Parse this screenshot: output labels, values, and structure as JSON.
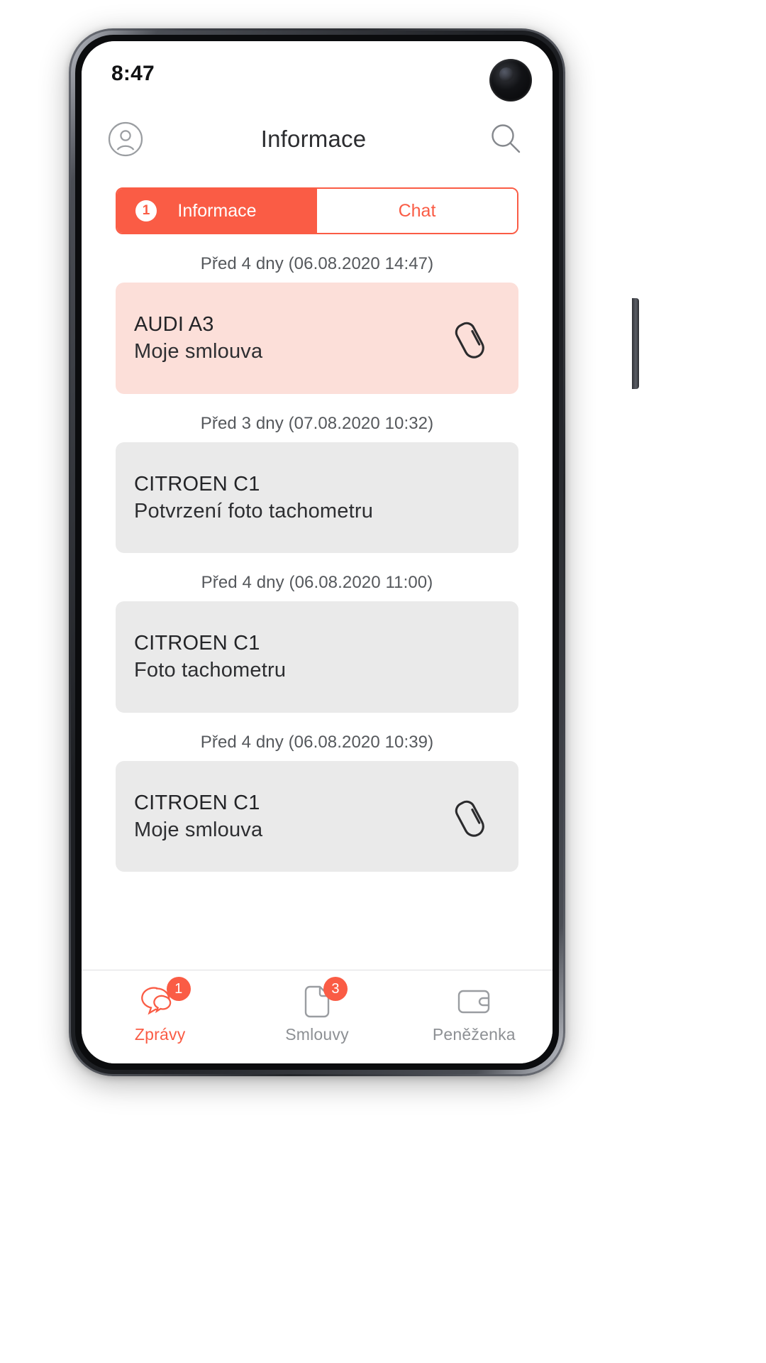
{
  "statusbar": {
    "time": "8:47"
  },
  "appbar": {
    "title": "Informace",
    "profile_icon": "user-circle-icon",
    "search_icon": "search-icon"
  },
  "segmented_tabs": [
    {
      "label": "Informace",
      "badge": "1",
      "active": true
    },
    {
      "label": "Chat",
      "badge": "",
      "active": false
    }
  ],
  "colors": {
    "accent": "#fa5c45",
    "unread_card_bg": "#fcdfd9",
    "read_card_bg": "#eaeaea",
    "inactive_nav": "#8d9094",
    "timestamp_text": "#55585c",
    "title_text": "#232427"
  },
  "messages": [
    {
      "timestamp": "Před 4 dny (06.08.2020 14:47)",
      "title": "AUDI A3",
      "subtitle": "Moje smlouva",
      "unread": true,
      "has_attachment": true,
      "attachment_icon": "paperclip-icon"
    },
    {
      "timestamp": "Před 3 dny (07.08.2020 10:32)",
      "title": "CITROEN C1",
      "subtitle": "Potvrzení  foto tachometru",
      "unread": false,
      "has_attachment": false,
      "attachment_icon": ""
    },
    {
      "timestamp": "Před 4 dny (06.08.2020 11:00)",
      "title": "CITROEN C1",
      "subtitle": "Foto tachometru",
      "unread": false,
      "has_attachment": false,
      "attachment_icon": ""
    },
    {
      "timestamp": "Před 4 dny (06.08.2020 10:39)",
      "title": "CITROEN C1",
      "subtitle": "Moje smlouva",
      "unread": false,
      "has_attachment": true,
      "attachment_icon": "paperclip-icon"
    }
  ],
  "bottom_nav": [
    {
      "label": "Zprávy",
      "badge": "1",
      "icon": "chat-bubbles-icon",
      "active": true
    },
    {
      "label": "Smlouvy",
      "badge": "3",
      "icon": "document-icon",
      "active": false
    },
    {
      "label": "Peněženka",
      "badge": "",
      "icon": "wallet-icon",
      "active": false
    }
  ]
}
